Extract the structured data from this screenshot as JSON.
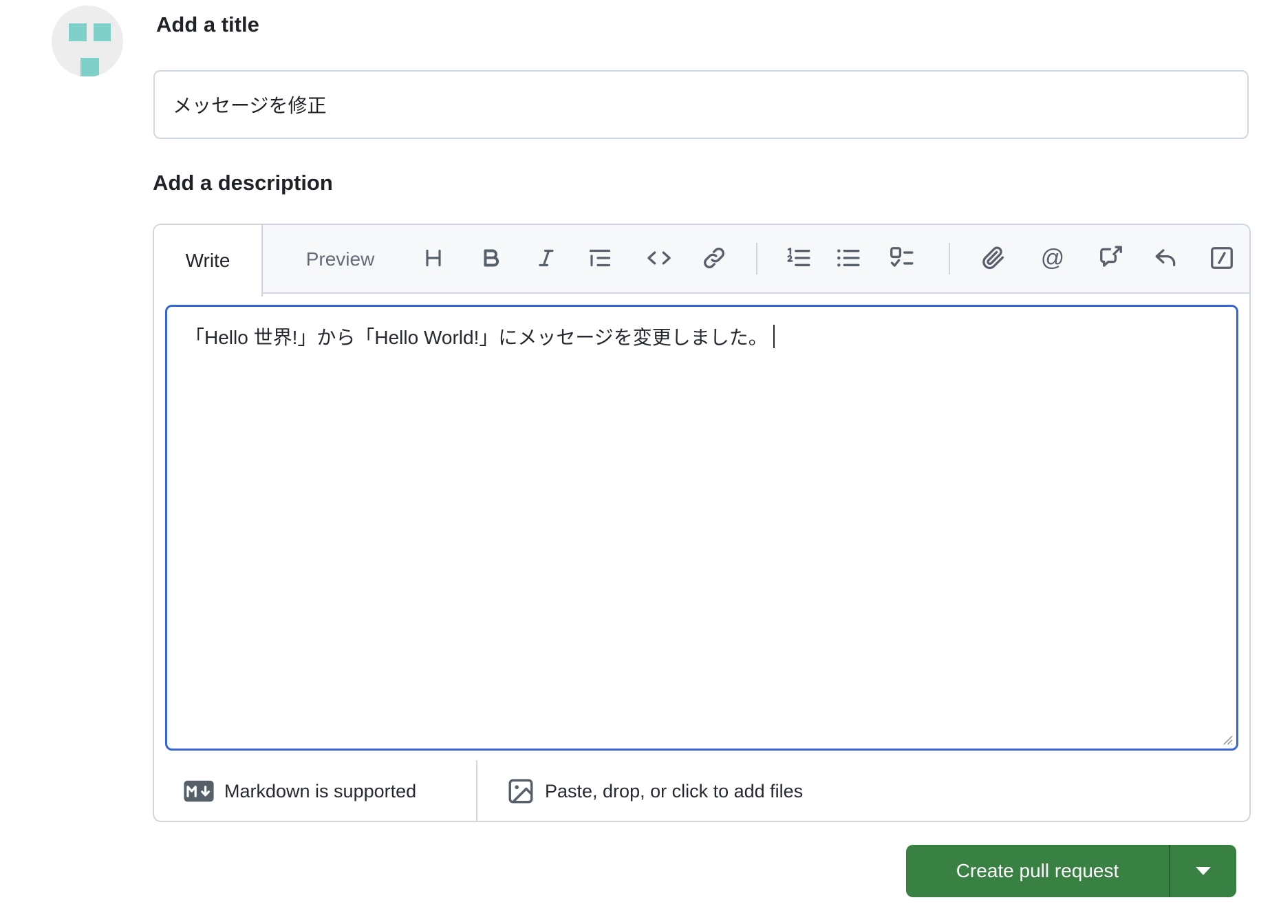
{
  "form": {
    "title_section": {
      "heading": "Add a title",
      "value": "メッセージを修正"
    },
    "description_section": {
      "heading": "Add a description",
      "tabs": {
        "write": "Write",
        "preview": "Preview"
      },
      "toolbar_icons": [
        "heading",
        "bold",
        "italic",
        "quote",
        "code",
        "link",
        "ordered-list",
        "unordered-list",
        "task-list",
        "attach-file",
        "mention",
        "cross-reference",
        "saved-replies",
        "slash-commands"
      ],
      "body_text": "「Hello 世界!」から「Hello World!」にメッセージを変更しました。",
      "footer": {
        "markdown_hint": "Markdown is supported",
        "paste_hint": "Paste, drop, or click to add files"
      }
    },
    "actions": {
      "create_pull_request": "Create pull request"
    }
  },
  "colors": {
    "accent_green": "#388142",
    "focus_blue": "#3565d9",
    "border": "#d0d7de",
    "toolbar_bg": "#f6f8fa",
    "icon_gray": "#57606a",
    "muted_text": "#636c76",
    "text": "#1f2328",
    "avatar_bg": "#ededed",
    "avatar_teal": "#7ed0c8"
  }
}
